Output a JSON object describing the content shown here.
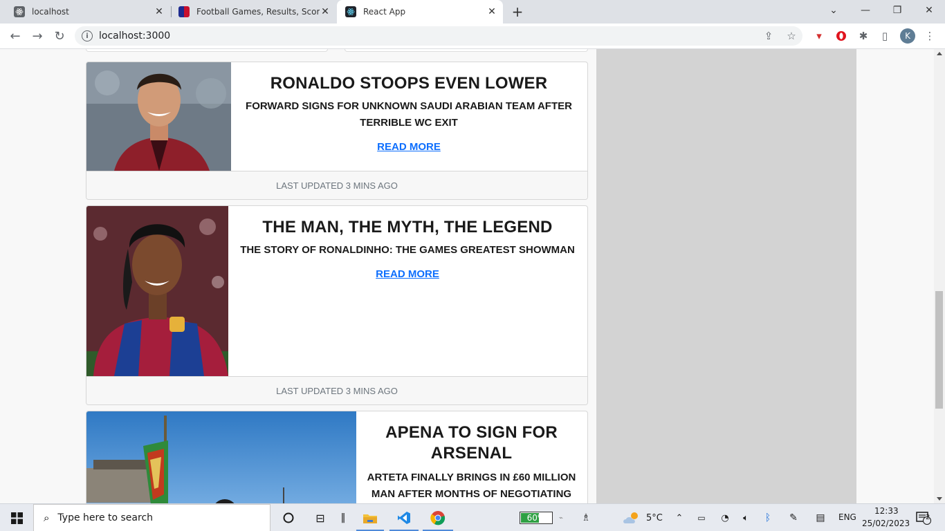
{
  "browser": {
    "tabs": [
      {
        "title": "localhost",
        "favicon": "react-icon"
      },
      {
        "title": "Football Games, Results, Scores, T",
        "favicon": "flag-icon"
      },
      {
        "title": "React App",
        "favicon": "react-icon",
        "active": true
      }
    ],
    "url": "localhost:3000",
    "profile_initial": "K"
  },
  "articles": [
    {
      "headline": "RONALDO STOOPS EVEN LOWER",
      "subheading": "FORWARD SIGNS FOR UNKNOWN SAUDI ARABIAN TEAM AFTER TERRIBLE WC EXIT",
      "read_more": "READ MORE",
      "footer": "LAST UPDATED 3 MINS AGO",
      "image": "player-photo"
    },
    {
      "headline": "THE MAN, THE MYTH, THE LEGEND",
      "subheading": "THE STORY OF RONALDINHO: THE GAMES GREATEST SHOWMAN",
      "read_more": "READ MORE",
      "footer": "LAST UPDATED 3 MINS AGO",
      "image": "player-photo"
    },
    {
      "headline": "APENA TO SIGN FOR ARSENAL",
      "subheading": "ARTETA FINALLY BRINGS IN £60 MILLION MAN AFTER MONTHS OF NEGOTIATING",
      "image": "stadium-photo"
    }
  ],
  "taskbar": {
    "search_placeholder": "Type here to search",
    "battery": "60%",
    "battery_level": 0.6,
    "temperature": "5°C",
    "language": "ENG",
    "time": "12:33",
    "date": "25/02/2023",
    "notifications": "2"
  },
  "colors": {
    "link": "#0d6efd",
    "sidebar": "#d3d3d3"
  }
}
